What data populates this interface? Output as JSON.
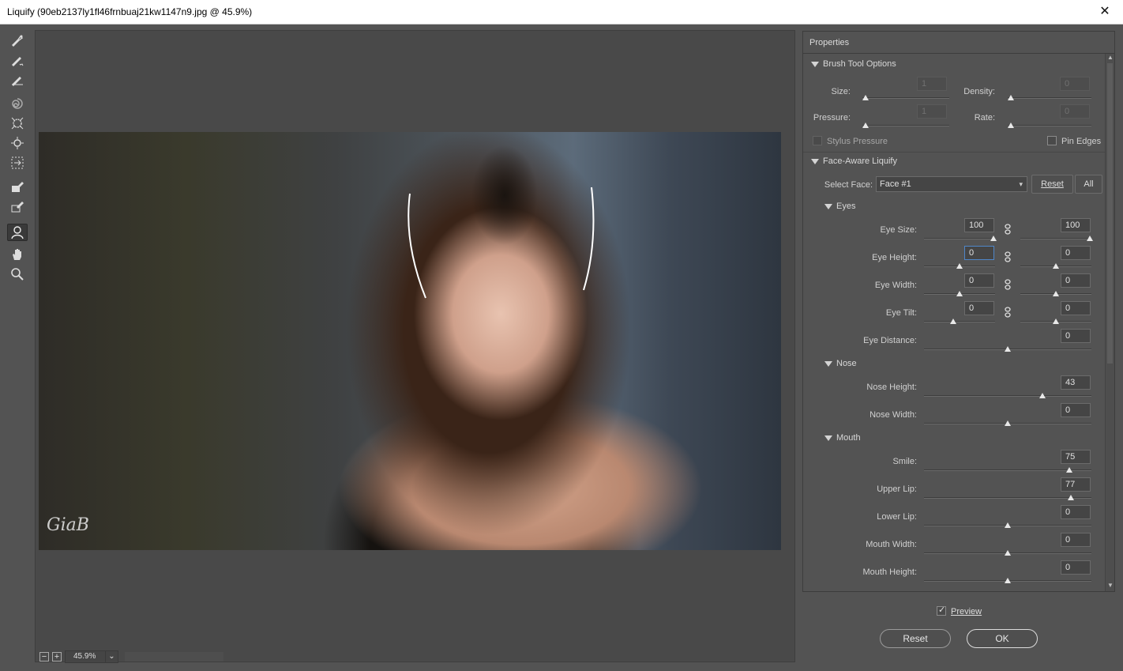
{
  "window": {
    "title": "Liquify (90eb2137ly1fl46frnbuaj21kw1147n9.jpg @ 45.9%)",
    "close_glyph": "✕"
  },
  "toolbar": {
    "tools": [
      {
        "name": "forward-warp-tool-icon",
        "active": false
      },
      {
        "name": "reconstruct-tool-icon",
        "active": false
      },
      {
        "name": "smooth-tool-icon",
        "active": false
      },
      {
        "name": "twirl-tool-icon",
        "active": false
      },
      {
        "name": "pucker-tool-icon",
        "active": false
      },
      {
        "name": "bloat-tool-icon",
        "active": false
      },
      {
        "name": "push-left-tool-icon",
        "active": false
      },
      {
        "name": "freeze-mask-tool-icon",
        "active": false
      },
      {
        "name": "thaw-mask-tool-icon",
        "active": false
      },
      {
        "name": "face-tool-icon",
        "active": true
      },
      {
        "name": "hand-tool-icon",
        "active": false
      },
      {
        "name": "zoom-tool-icon",
        "active": false
      }
    ]
  },
  "canvas": {
    "signature": "GiaB",
    "zoom": "45.9%",
    "zoom_out": "−",
    "zoom_in": "+",
    "zoom_dropdown": "⌄"
  },
  "properties": {
    "header": "Properties",
    "brush_tool_options": {
      "title": "Brush Tool Options",
      "size_label": "Size:",
      "size_value": "1",
      "density_label": "Density:",
      "density_value": "0",
      "pressure_label": "Pressure:",
      "pressure_value": "1",
      "rate_label": "Rate:",
      "rate_value": "0",
      "stylus_pressure_label": "Stylus Pressure",
      "pin_edges_label": "Pin Edges"
    },
    "face_aware": {
      "title": "Face-Aware Liquify",
      "select_face_label": "Select Face:",
      "select_face_value": "Face #1",
      "reset_label": "Reset",
      "all_label": "All",
      "eyes_title": "Eyes",
      "eye_size_label": "Eye Size:",
      "eye_size_left": "100",
      "eye_size_right": "100",
      "eye_height_label": "Eye Height:",
      "eye_height_left": "0",
      "eye_height_right": "0",
      "eye_width_label": "Eye Width:",
      "eye_width_left": "0",
      "eye_width_right": "0",
      "eye_tilt_label": "Eye Tilt:",
      "eye_tilt_left": "0",
      "eye_tilt_right": "0",
      "eye_distance_label": "Eye Distance:",
      "eye_distance_value": "0",
      "nose_title": "Nose",
      "nose_height_label": "Nose Height:",
      "nose_height_value": "43",
      "nose_width_label": "Nose Width:",
      "nose_width_value": "0",
      "mouth_title": "Mouth",
      "smile_label": "Smile:",
      "smile_value": "75",
      "upper_lip_label": "Upper Lip:",
      "upper_lip_value": "77",
      "lower_lip_label": "Lower Lip:",
      "lower_lip_value": "0",
      "mouth_width_label": "Mouth Width:",
      "mouth_width_value": "0",
      "mouth_height_label": "Mouth Height:",
      "mouth_height_value": "0"
    }
  },
  "footer": {
    "preview_label": "Preview",
    "reset_label": "Reset",
    "ok_label": "OK"
  },
  "colors": {
    "panel": "#535353",
    "canvas": "#494949",
    "accent_focus": "#4f86c8"
  }
}
